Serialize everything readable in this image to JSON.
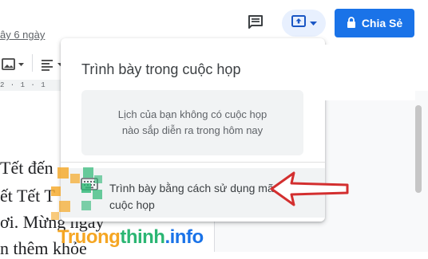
{
  "header": {
    "last_edit": "ây 6 ngày",
    "share_label": "Chia Sẻ"
  },
  "toolbar": {
    "ruler_text": "2 · 1 · 1"
  },
  "document": {
    "lines": [
      "Tết đến",
      "ết Tết T",
      "ơi. Mừng ngày",
      "n thêm khỏe"
    ]
  },
  "present_menu": {
    "title": "Trình bày trong cuộc họp",
    "no_meetings_line1": "Lịch của bạn không có cuộc họp",
    "no_meetings_line2": "nào sắp diễn ra trong hôm nay",
    "present_with_code_line1": "Trình bày bằng cách sử dụng mã",
    "present_with_code_line2": "cuộc họp"
  },
  "watermark": {
    "part1": "Truong",
    "part2": "thinh",
    "part3": ".info"
  },
  "colors": {
    "share_button": "#1a73e8",
    "present_button_bg": "#e8f0fe",
    "arrow": "#d32f2f"
  },
  "icons": {
    "comment": "comment-icon",
    "present": "present-to-screen-icon",
    "lock": "lock-icon",
    "keyboard": "keyboard-icon"
  }
}
